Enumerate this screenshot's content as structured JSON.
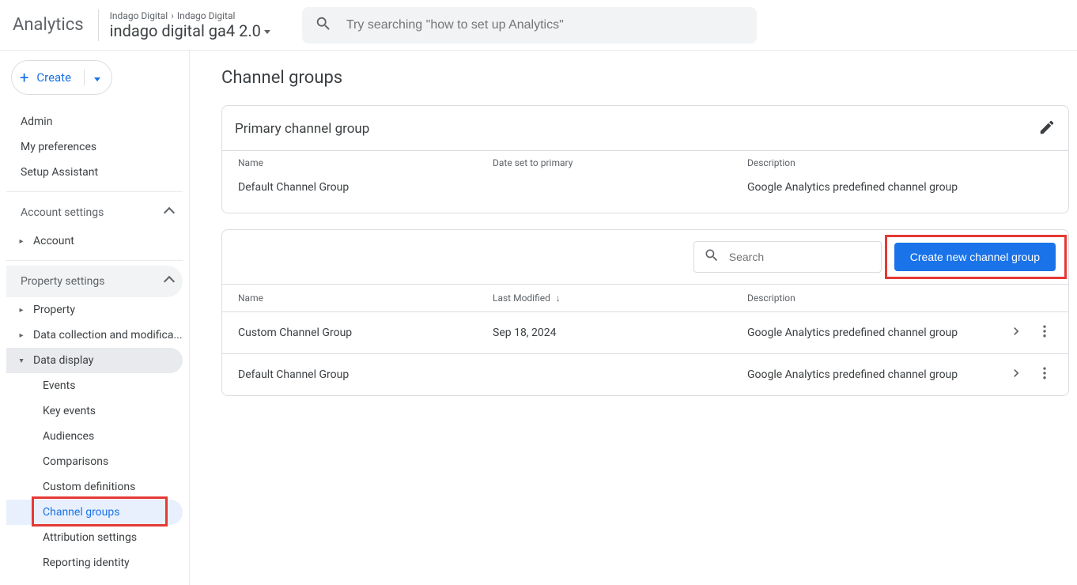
{
  "header": {
    "brand": "Analytics",
    "crumb1": "Indago Digital",
    "crumb2": "Indago Digital",
    "property": "indago digital ga4 2.0",
    "search_placeholder": "Try searching \"how to set up Analytics\""
  },
  "sidebar": {
    "create": "Create",
    "primary": [
      "Admin",
      "My preferences",
      "Setup Assistant"
    ],
    "account_section": "Account settings",
    "account_items": [
      "Account"
    ],
    "property_section": "Property settings",
    "property_items": {
      "property": "Property",
      "data_collection": "Data collection and modifica...",
      "data_display": "Data display"
    },
    "data_display_children": [
      "Events",
      "Key events",
      "Audiences",
      "Comparisons",
      "Custom definitions",
      "Channel groups",
      "Attribution settings",
      "Reporting identity"
    ]
  },
  "main": {
    "title": "Channel groups",
    "primary_card": {
      "title": "Primary channel group",
      "cols": {
        "name": "Name",
        "date": "Date set to primary",
        "desc": "Description"
      },
      "row": {
        "name": "Default Channel Group",
        "date": "",
        "desc": "Google Analytics predefined channel group"
      }
    },
    "list_card": {
      "search_placeholder": "Search",
      "create_btn": "Create new channel group",
      "cols": {
        "name": "Name",
        "modified": "Last Modified",
        "desc": "Description"
      },
      "rows": [
        {
          "name": "Custom Channel Group",
          "modified": "Sep 18, 2024",
          "desc": "Google Analytics predefined channel group"
        },
        {
          "name": "Default Channel Group",
          "modified": "",
          "desc": "Google Analytics predefined channel group"
        }
      ]
    }
  }
}
